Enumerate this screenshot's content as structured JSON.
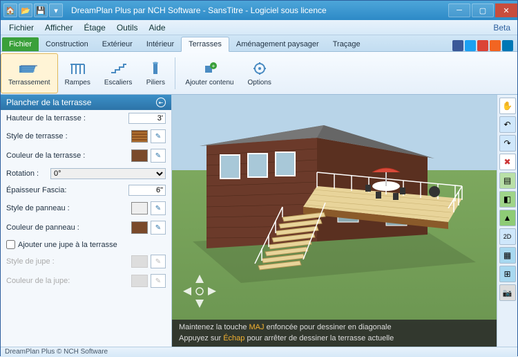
{
  "window": {
    "title": "DreamPlan Plus par NCH Software - SansTitre - Logiciel sous licence",
    "beta": "Beta"
  },
  "menu": [
    "Fichier",
    "Afficher",
    "Étage",
    "Outils",
    "Aide"
  ],
  "tabs": {
    "file": "Fichier",
    "items": [
      "Construction",
      "Extérieur",
      "Intérieur",
      "Terrasses",
      "Aménagement paysager",
      "Traçage"
    ],
    "active": "Terrasses"
  },
  "ribbon": {
    "terrassement": "Terrassement",
    "rampes": "Rampes",
    "escaliers": "Escaliers",
    "piliers": "Piliers",
    "ajouter": "Ajouter contenu",
    "options": "Options"
  },
  "panel": {
    "title": "Plancher de la terrasse",
    "height_lbl": "Hauteur de la terrasse :",
    "height_val": "3'",
    "style_lbl": "Style de terrasse :",
    "color_lbl": "Couleur de la terrasse :",
    "color_val": "#7a4a2a",
    "rotation_lbl": "Rotation :",
    "rotation_val": "0°",
    "fascia_lbl": "Épaisseur Fascia:",
    "fascia_val": "6\"",
    "panel_style_lbl": "Style de panneau :",
    "panel_color_lbl": "Couleur de panneau :",
    "panel_color_val": "#7a4a2a",
    "skirt_chk": "Ajouter une jupe à la terrasse",
    "skirt_style_lbl": "Style de jupe :",
    "skirt_color_lbl": "Couleur de la jupe:"
  },
  "hint": {
    "l1a": "Maintenez la touche ",
    "l1b": "MAJ",
    "l1c": " enfoncée pour dessiner en diagonale",
    "l2a": "Appuyez sur ",
    "l2b": "Échap",
    "l2c": " pour arrêter de dessiner la terrasse actuelle"
  },
  "status": "DreamPlan Plus © NCH Software",
  "social_colors": [
    "#3b5998",
    "#1da1f2",
    "#db4437",
    "#f26522",
    "#0077b5"
  ],
  "tools": [
    {
      "name": "pan-icon",
      "glyph": "✋",
      "bg": "#fff"
    },
    {
      "name": "undo-icon",
      "glyph": "↶",
      "bg": "#cfe7fb"
    },
    {
      "name": "redo-icon",
      "glyph": "↷",
      "bg": "#cfe7fb"
    },
    {
      "name": "delete-icon",
      "glyph": "✖",
      "bg": "#fff",
      "color": "#c33"
    },
    {
      "name": "layers-icon",
      "glyph": "▤",
      "bg": "#b9e0a8"
    },
    {
      "name": "materials-icon",
      "glyph": "◧",
      "bg": "#9fd48a"
    },
    {
      "name": "terrain-icon",
      "glyph": "▲",
      "bg": "#8ecb76"
    },
    {
      "name": "view2d-icon",
      "glyph": "2D",
      "bg": "#cfe7fb",
      "fs": "9px"
    },
    {
      "name": "grid-icon",
      "glyph": "▦",
      "bg": "#a8d8f0"
    },
    {
      "name": "snap-icon",
      "glyph": "⊞",
      "bg": "#a8d8f0"
    },
    {
      "name": "camera-icon",
      "glyph": "📷",
      "bg": "#ddd",
      "fs": "11px"
    }
  ]
}
